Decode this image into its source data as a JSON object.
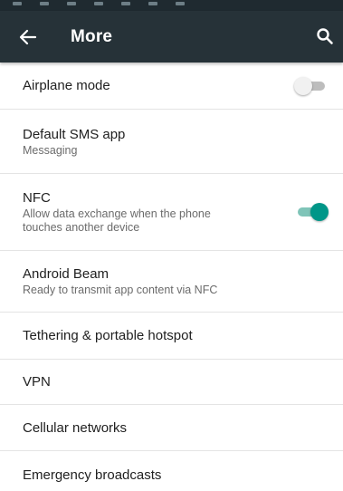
{
  "toolbar": {
    "title": "More",
    "back_icon": "arrow-left-icon",
    "search_icon": "search-icon",
    "background": "#263238"
  },
  "settings": {
    "airplane": {
      "label": "Airplane mode",
      "toggle_on": false
    },
    "sms": {
      "label": "Default SMS app",
      "sub": "Messaging"
    },
    "nfc": {
      "label": "NFC",
      "sub": "Allow data exchange when the phone touches another device",
      "toggle_on": true
    },
    "beam": {
      "label": "Android Beam",
      "sub": "Ready to transmit app content via NFC"
    },
    "tether": {
      "label": "Tethering & portable hotspot"
    },
    "vpn": {
      "label": "VPN"
    },
    "cellular": {
      "label": "Cellular networks"
    },
    "emergency": {
      "label": "Emergency broadcasts"
    }
  },
  "colors": {
    "accent": "#009688",
    "accent_track": "#7fc4b8",
    "off_track": "#bdbdbd",
    "text_primary": "#212121",
    "text_secondary": "#6b6b6b"
  }
}
